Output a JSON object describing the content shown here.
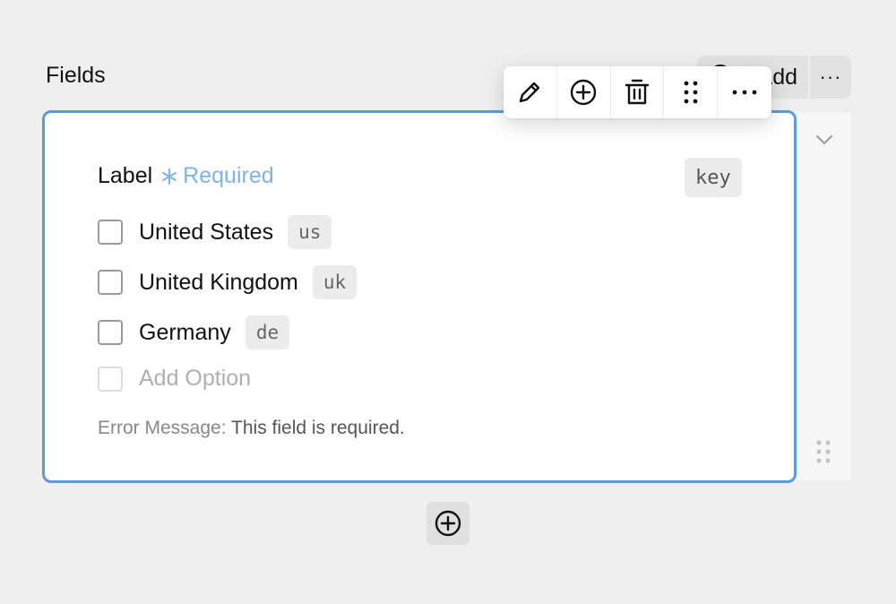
{
  "header": {
    "title": "Fields",
    "add_label": "Add",
    "more_label": "···"
  },
  "field": {
    "label": "Label",
    "required_label": "Required",
    "key": "key",
    "options": [
      {
        "label": "United States",
        "code": "us"
      },
      {
        "label": "United Kingdom",
        "code": "uk"
      },
      {
        "label": "Germany",
        "code": "de"
      }
    ],
    "add_option_placeholder": "Add Option",
    "error_label": "Error Message:",
    "error_text": "This field is required."
  },
  "toolbar": {
    "items": [
      "pencil-icon",
      "plus-circle-icon",
      "trash-icon",
      "drag-handle-icon",
      "more-icon"
    ]
  },
  "colors": {
    "accent": "#5c9bdb",
    "required": "#7fb3e6",
    "background": "#efefef"
  }
}
